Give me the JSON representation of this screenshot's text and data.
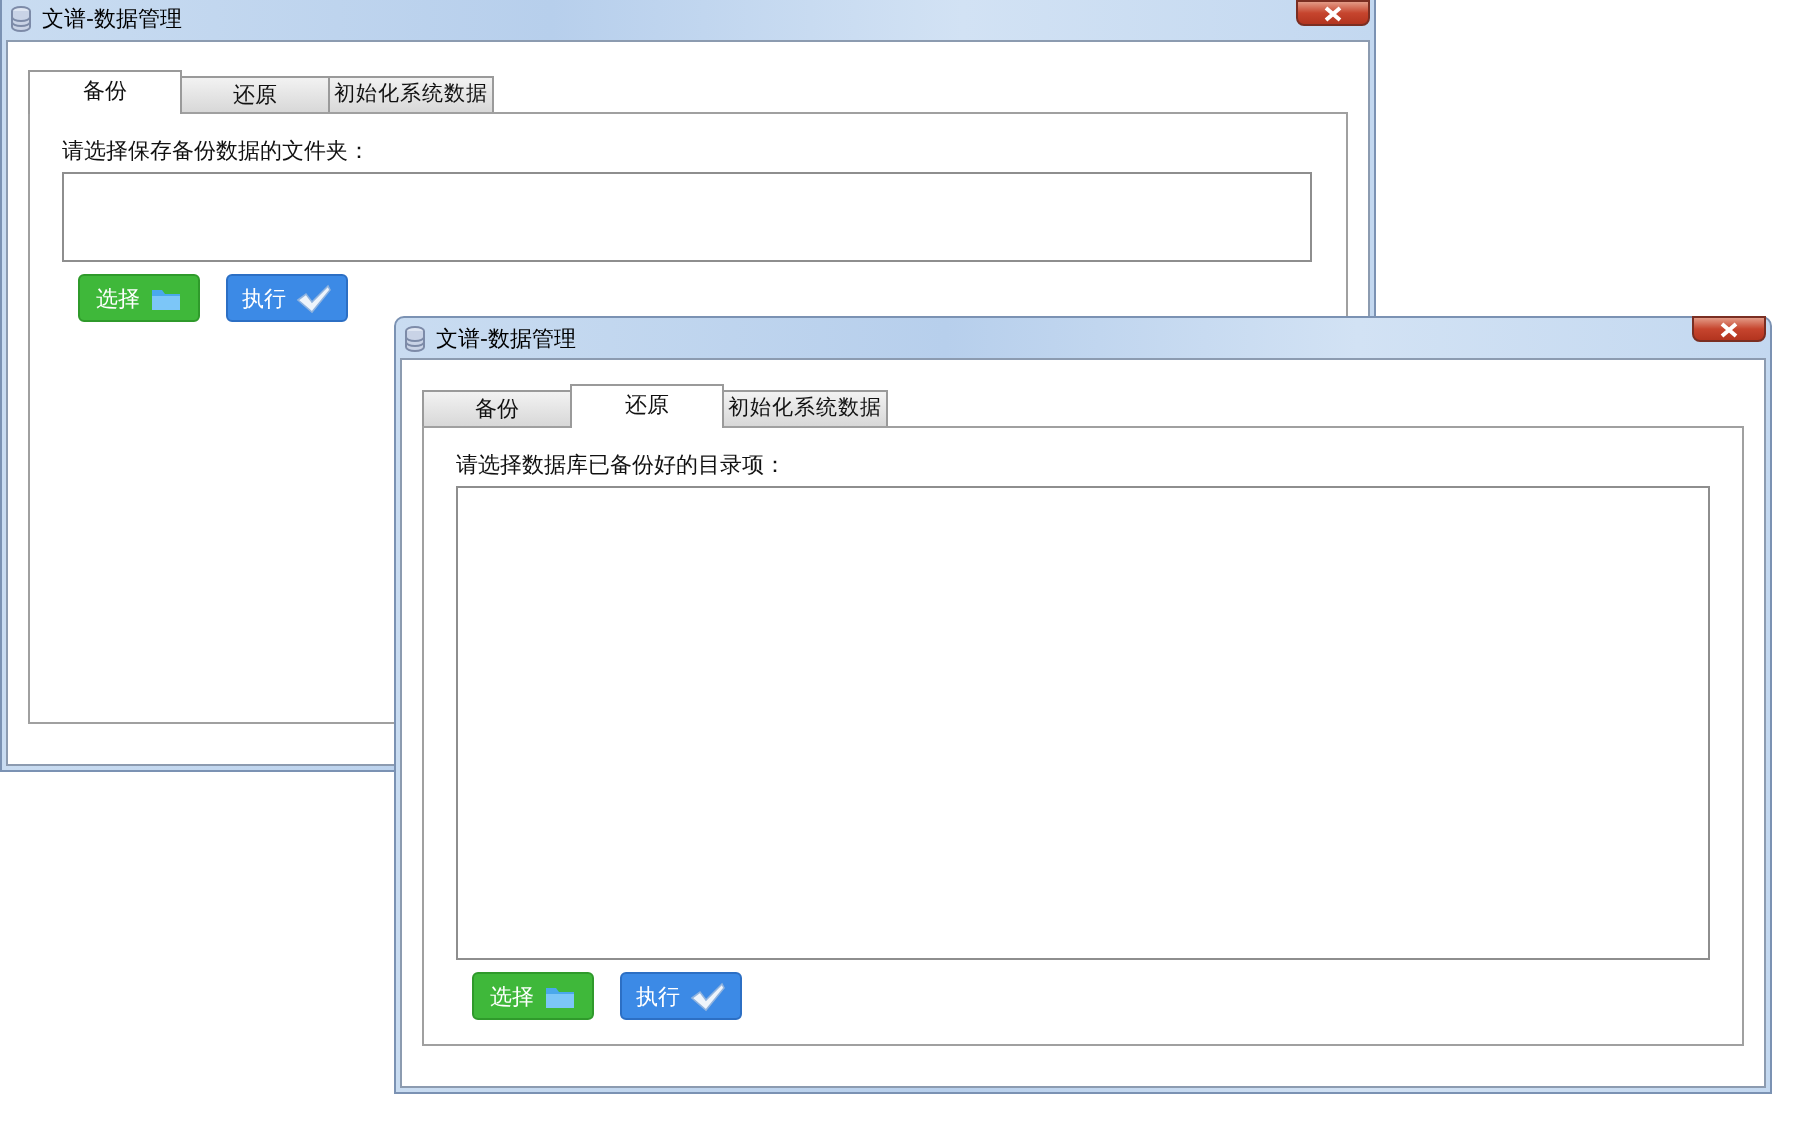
{
  "windows": [
    {
      "title": "文谱-数据管理",
      "tabs": [
        {
          "label": "备份",
          "selected": true
        },
        {
          "label": "还原",
          "selected": false
        },
        {
          "label": "初始化系统数据",
          "selected": false
        }
      ],
      "prompt": "请选择保存备份数据的文件夹：",
      "field": {
        "kind": "textbox"
      },
      "buttons": [
        {
          "label": "选择",
          "kind": "folder"
        },
        {
          "label": "执行",
          "kind": "check"
        }
      ]
    },
    {
      "title": "文谱-数据管理",
      "tabs": [
        {
          "label": "备份",
          "selected": false
        },
        {
          "label": "还原",
          "selected": true
        },
        {
          "label": "初始化系统数据",
          "selected": false
        }
      ],
      "prompt": "请选择数据库已备份好的目录项：",
      "field": {
        "kind": "listbox"
      },
      "buttons": [
        {
          "label": "选择",
          "kind": "folder"
        },
        {
          "label": "执行",
          "kind": "check"
        }
      ]
    }
  ]
}
